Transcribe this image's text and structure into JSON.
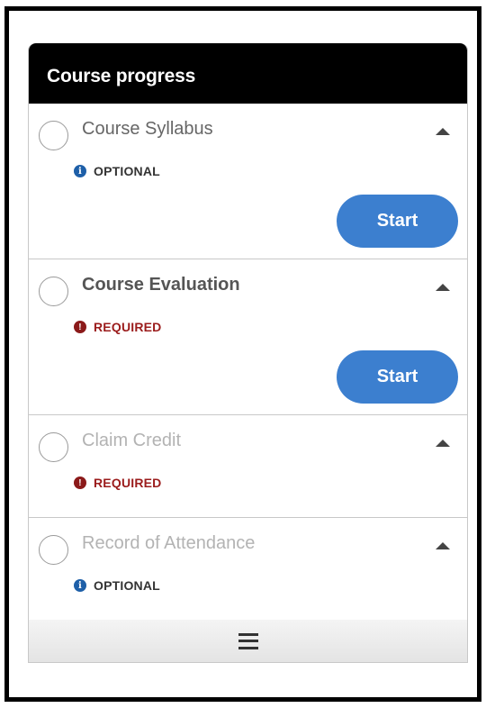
{
  "panel": {
    "title": "Course progress"
  },
  "items": [
    {
      "title": "Course Syllabus",
      "status": "OPTIONAL",
      "status_type": "optional",
      "button": "Start"
    },
    {
      "title": "Course Evaluation",
      "status": "REQUIRED",
      "status_type": "required",
      "button": "Start"
    },
    {
      "title": "Claim Credit",
      "status": "REQUIRED",
      "status_type": "required"
    },
    {
      "title": "Record of Attendance",
      "status": "OPTIONAL",
      "status_type": "optional"
    }
  ],
  "icons": {
    "info": "i",
    "alert": "!",
    "menu": "hamburger-menu-icon",
    "collapse": "caret-up-icon"
  },
  "colors": {
    "header_bg": "#000000",
    "button_bg": "#3c7fcf",
    "optional_icon": "#1e5fa8",
    "required_text": "#9b1c1c"
  }
}
